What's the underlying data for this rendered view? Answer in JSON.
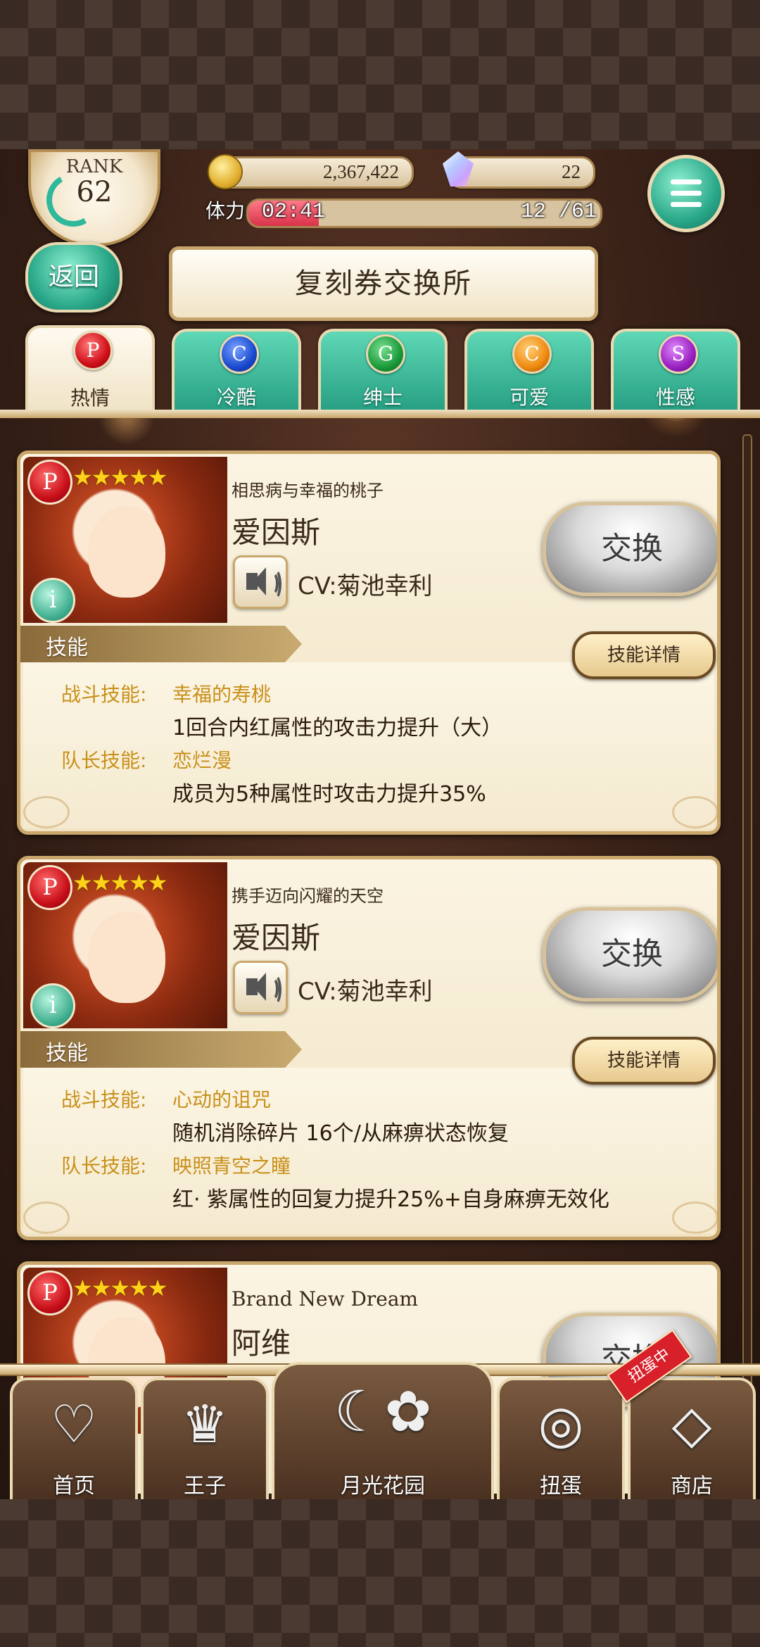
{
  "top_bar": {
    "rank_label": "RANK",
    "rank_value": "62",
    "coins": "2,367,422",
    "gems": "22",
    "stamina_label": "体力",
    "stamina_timer": "02:41",
    "stamina_value": "12 /61",
    "stamina_fraction": 0.2,
    "menu_icon": "hamburger-menu-icon"
  },
  "header": {
    "back_label": "返回",
    "title": "复刻券交换所"
  },
  "tabs": [
    {
      "label": "热情",
      "glyph": "P",
      "color": "#d0101a",
      "active": true
    },
    {
      "label": "冷酷",
      "glyph": "C",
      "color": "#1a4ad0",
      "active": false
    },
    {
      "label": "绅士",
      "glyph": "G",
      "color": "#1a9a3a",
      "active": false
    },
    {
      "label": "可爱",
      "glyph": "C",
      "color": "#f08a10",
      "active": false
    },
    {
      "label": "性感",
      "glyph": "S",
      "color": "#9a20c0",
      "active": false
    }
  ],
  "cards": [
    {
      "attribute": "P",
      "stars": "★★★★★",
      "info": "i",
      "subtitle": "相思病与幸福的桃子",
      "name": "爱因斯",
      "cv": "CV:菊池幸利",
      "exchange_label": "交换",
      "skill_heading": "技能",
      "skill_detail_label": "技能详情",
      "battle_label": "战斗技能:",
      "battle_name": "幸福的寿桃",
      "battle_desc": "1回合内红属性的攻击力提升（大）",
      "leader_label": "队长技能:",
      "leader_name": "恋烂漫",
      "leader_desc": "成员为5种属性时攻击力提升35%"
    },
    {
      "attribute": "P",
      "stars": "★★★★★",
      "info": "i",
      "subtitle": "携手迈向闪耀的天空",
      "name": "爱因斯",
      "cv": "CV:菊池幸利",
      "exchange_label": "交换",
      "skill_heading": "技能",
      "skill_detail_label": "技能详情",
      "battle_label": "战斗技能:",
      "battle_name": "心动的诅咒",
      "battle_desc": "随机消除碎片 16个/从麻痹状态恢复",
      "leader_label": "队长技能:",
      "leader_name": "映照青空之瞳",
      "leader_desc": "红· 紫属性的回复力提升25%+自身麻痹无效化"
    },
    {
      "attribute": "P",
      "stars": "★★★★★",
      "subtitle": "Brand New Dream",
      "name": "阿维",
      "exchange_label": "交换"
    }
  ],
  "bottom_nav": [
    {
      "label": "首页",
      "icon": "heart-icon"
    },
    {
      "label": "王子",
      "icon": "crown-icon"
    },
    {
      "label": "月光花园",
      "icon": "moon-garden-icon"
    },
    {
      "label": "扭蛋",
      "icon": "gacha-ring-icon"
    },
    {
      "label": "商店",
      "icon": "shop-gem-icon",
      "ribbon": "扭蛋中"
    }
  ]
}
